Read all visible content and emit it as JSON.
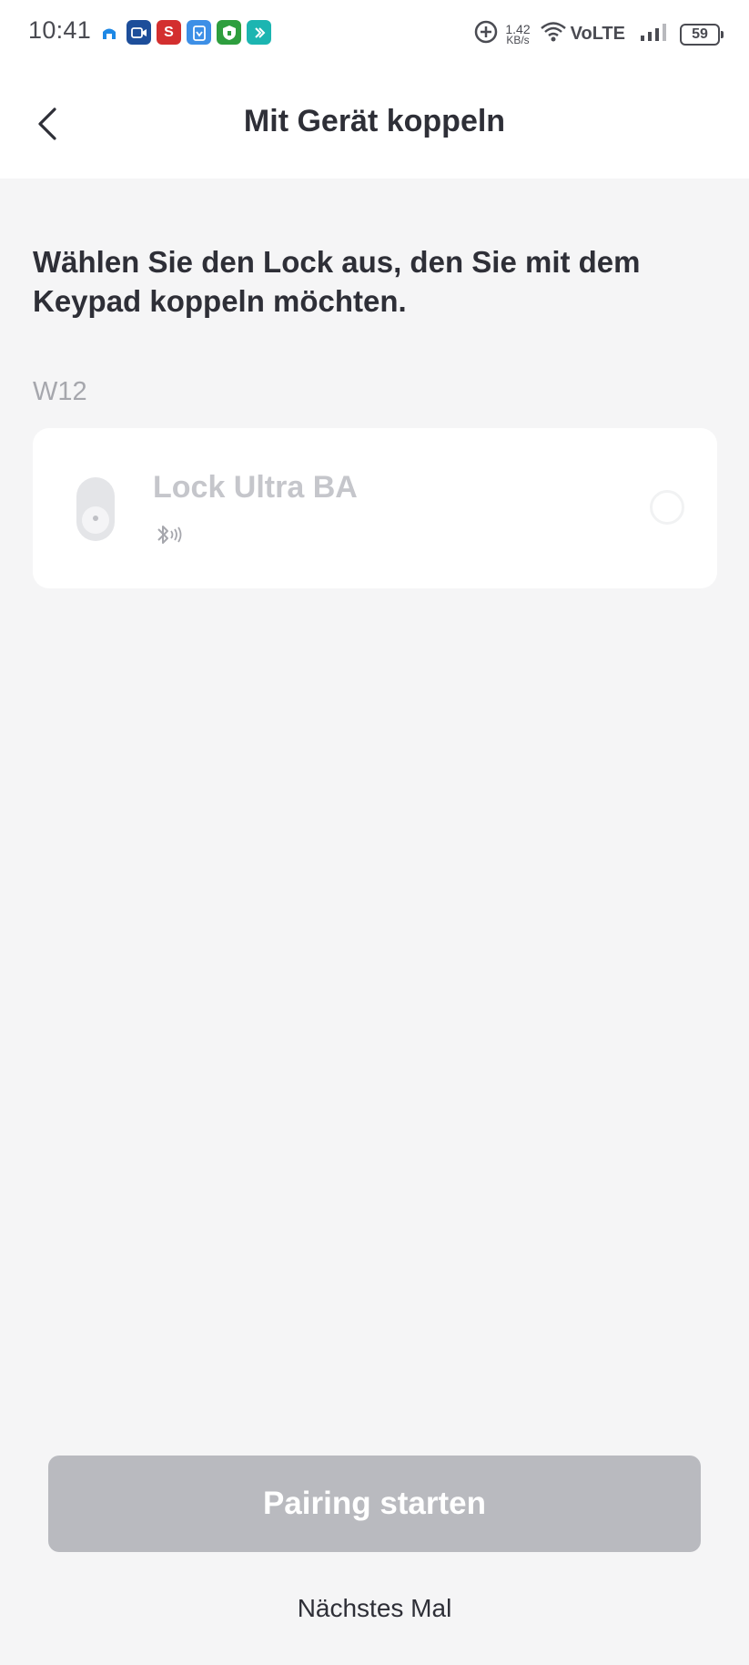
{
  "status_bar": {
    "time": "10:41",
    "apps": [
      {
        "icon": "home-app-icon",
        "color": "#1e88e5"
      },
      {
        "icon": "video-app-icon",
        "color": "#1d4e9a"
      },
      {
        "icon": "s-app-icon",
        "color": "#d32f2f",
        "glyph": "S"
      },
      {
        "icon": "clipboard-app-icon",
        "color": "#3d8fe6"
      },
      {
        "icon": "shield-app-icon",
        "color": "#2e9e3e"
      },
      {
        "icon": "teal-app-icon",
        "color": "#1cb5b1"
      }
    ],
    "net_speed_value": "1.42",
    "net_speed_unit": "KB/s",
    "network_label": "VoLTE",
    "battery_level": "59"
  },
  "header": {
    "title": "Mit Gerät koppeln"
  },
  "main": {
    "instruction": "Wählen Sie den Lock aus, den Sie mit dem Keypad koppeln möchten.",
    "group_label": "W12",
    "devices": [
      {
        "name": "Lock Ultra BA",
        "connection_icon": "bluetooth-icon",
        "selected": false
      }
    ]
  },
  "footer": {
    "primary_label": "Pairing starten",
    "secondary_label": "Nächstes Mal"
  },
  "colors": {
    "background": "#f5f5f6",
    "surface": "#ffffff",
    "primary_text": "#2e2f37",
    "muted_text": "#a6a7ad",
    "disabled_button": "#b9babf"
  }
}
